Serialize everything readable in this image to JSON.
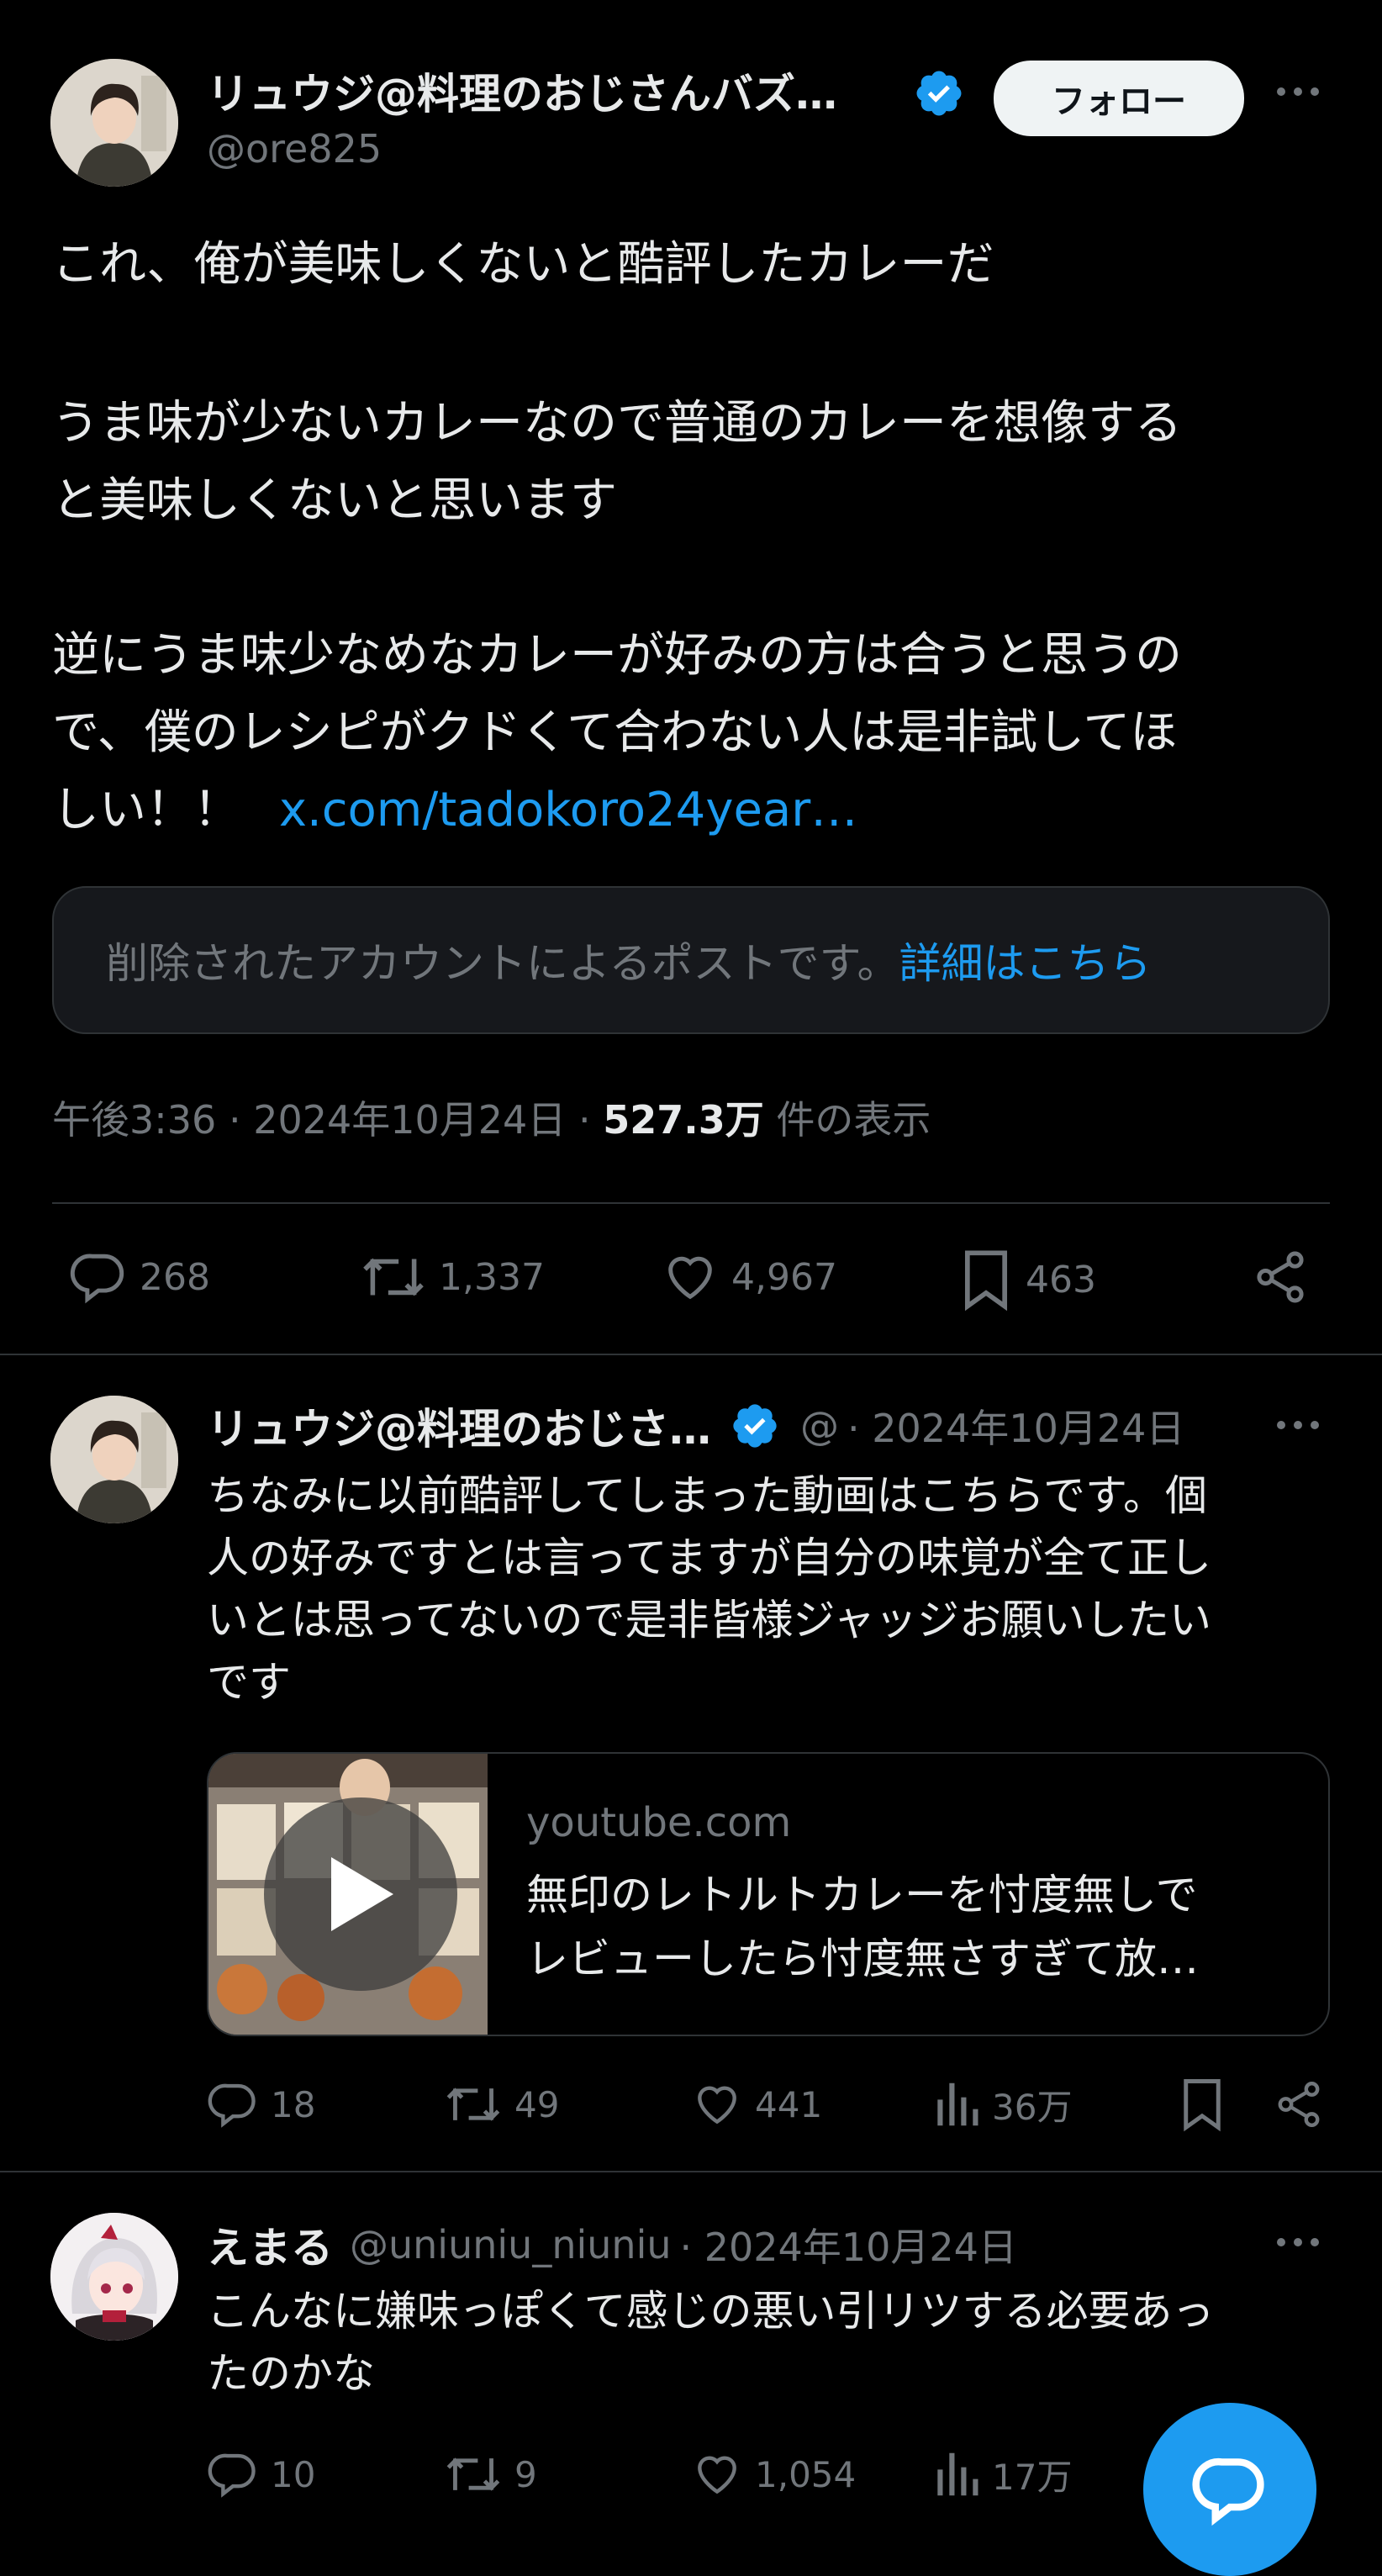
{
  "colors": {
    "background": "#000000",
    "text": "#e7e9ea",
    "muted": "#71767b",
    "accent": "#1d9bf0",
    "divider": "#2f3336"
  },
  "main_post": {
    "author_name": "リュウジ@料理のおじさんバズ…",
    "handle": "@ore825",
    "follow_label": "フォロー",
    "more_icon": "more-icon",
    "text_line1": "これ、俺が美味しくないと酷評したカレーだ",
    "text_para2_line1": "うま味が少ないカレーなので普通のカレーを想像する",
    "text_para2_line2": "と美味しくないと思います",
    "text_para3_line1": "逆にうま味少なめなカレーが好みの方は合うと思うの",
    "text_para3_line2": "で、僕のレシピがクドくて合わない人は是非試してほ",
    "text_para3_line3": "しい！！",
    "link_text": "x.com/tadokoro24year…",
    "quote_notice": "削除されたアカウントによるポストです。",
    "quote_link": "詳細はこちら",
    "time": "午後3:36",
    "date": "2024年10月24日",
    "views_count": "527.3万",
    "views_label": "件の表示",
    "dot": "·",
    "replies": "268",
    "reposts": "1,337",
    "likes": "4,967",
    "bookmarks": "463"
  },
  "reply1": {
    "author_name": "リュウジ@料理のおじさ…",
    "handle": "@",
    "meta": "· 2024年10月24日",
    "text_line1": "ちなみに以前酷評してしまった動画はこちらです。個",
    "text_line2": "人の好みですとは言ってますが自分の味覚が全て正し",
    "text_line3": "いとは思ってないので是非皆様ジャッジお願いしたい",
    "text_line4": "です",
    "card_domain": "youtube.com",
    "card_title_line1": "無印のレトルトカレーを忖度無しで",
    "card_title_line2": "レビューしたら忖度無さすぎて放…",
    "replies": "18",
    "reposts": "49",
    "likes": "441",
    "views": "36万"
  },
  "reply2": {
    "author_name": "えまる",
    "handle": "@uniuniu_niuniu",
    "meta": "· 2024年10月24日",
    "text_line1": "こんなに嫌味っぽくて感じの悪い引リツする必要あっ",
    "text_line2": "たのかな",
    "replies": "10",
    "reposts": "9",
    "likes": "1,054",
    "views": "17万"
  },
  "fab": {
    "icon": "compose-reply-icon"
  }
}
